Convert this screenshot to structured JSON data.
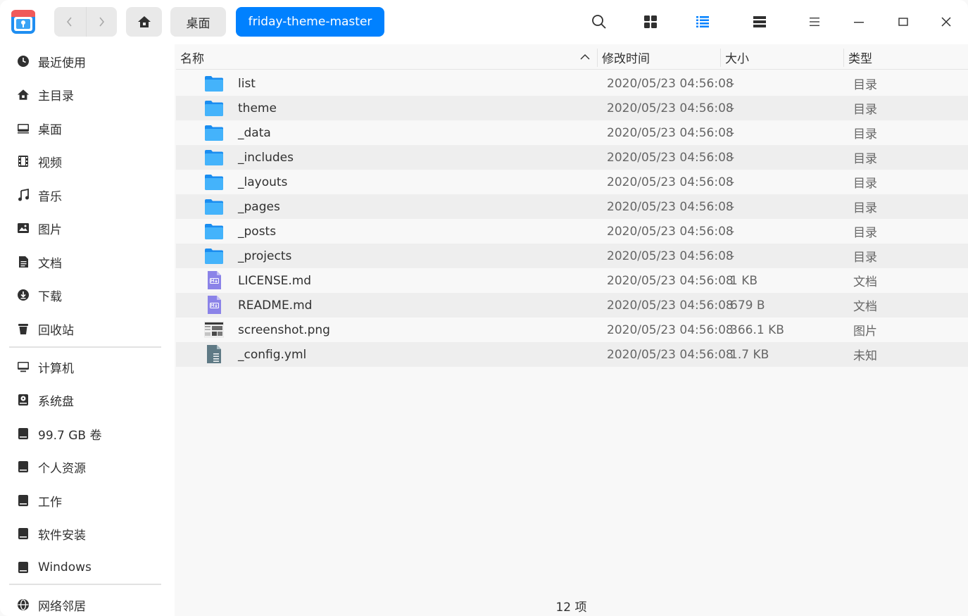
{
  "breadcrumbs": {
    "parent": "桌面",
    "current": "friday-theme-master"
  },
  "toolbar": {
    "icons": [
      "search-icon",
      "icon-view-icon",
      "list-view-icon",
      "detail-view-icon",
      "menu-icon",
      "minimize-icon",
      "maximize-icon",
      "close-icon"
    ]
  },
  "colors": {
    "accent": "#0081ff",
    "folder": "#2da0f2",
    "markdown": "#8b83e8"
  },
  "sidebar": {
    "items": [
      {
        "label": "最近使用",
        "icon": "clock-icon"
      },
      {
        "label": "主目录",
        "icon": "home-icon"
      },
      {
        "label": "桌面",
        "icon": "desktop-icon"
      },
      {
        "label": "视频",
        "icon": "video-icon"
      },
      {
        "label": "音乐",
        "icon": "music-icon"
      },
      {
        "label": "图片",
        "icon": "picture-icon"
      },
      {
        "label": "文档",
        "icon": "document-icon"
      },
      {
        "label": "下载",
        "icon": "download-icon"
      },
      {
        "label": "回收站",
        "icon": "trash-icon"
      }
    ],
    "devices": [
      {
        "label": "计算机",
        "icon": "computer-icon"
      },
      {
        "label": "系统盘",
        "icon": "system-disk-icon"
      },
      {
        "label": "99.7 GB 卷",
        "icon": "drive-icon"
      },
      {
        "label": "个人资源",
        "icon": "drive-icon"
      },
      {
        "label": "工作",
        "icon": "drive-icon"
      },
      {
        "label": "软件安装",
        "icon": "drive-icon"
      },
      {
        "label": "Windows",
        "icon": "drive-icon"
      }
    ],
    "network": {
      "label": "网络邻居",
      "icon": "network-icon"
    }
  },
  "columns": {
    "name": "名称",
    "modified": "修改时间",
    "size": "大小",
    "type": "类型"
  },
  "files": [
    {
      "name": "list",
      "modified": "2020/05/23 04:56:08",
      "size": "-",
      "type": "目录",
      "icon": "folder-icon"
    },
    {
      "name": "theme",
      "modified": "2020/05/23 04:56:08",
      "size": "-",
      "type": "目录",
      "icon": "folder-icon"
    },
    {
      "name": "_data",
      "modified": "2020/05/23 04:56:08",
      "size": "-",
      "type": "目录",
      "icon": "folder-icon"
    },
    {
      "name": "_includes",
      "modified": "2020/05/23 04:56:08",
      "size": "-",
      "type": "目录",
      "icon": "folder-icon"
    },
    {
      "name": "_layouts",
      "modified": "2020/05/23 04:56:08",
      "size": "-",
      "type": "目录",
      "icon": "folder-icon"
    },
    {
      "name": "_pages",
      "modified": "2020/05/23 04:56:08",
      "size": "-",
      "type": "目录",
      "icon": "folder-icon"
    },
    {
      "name": "_posts",
      "modified": "2020/05/23 04:56:08",
      "size": "-",
      "type": "目录",
      "icon": "folder-icon"
    },
    {
      "name": "_projects",
      "modified": "2020/05/23 04:56:08",
      "size": "-",
      "type": "目录",
      "icon": "folder-icon"
    },
    {
      "name": "LICENSE.md",
      "modified": "2020/05/23 04:56:08",
      "size": "1 KB",
      "type": "文档",
      "icon": "markdown-file-icon"
    },
    {
      "name": "README.md",
      "modified": "2020/05/23 04:56:08",
      "size": "679 B",
      "type": "文档",
      "icon": "markdown-file-icon"
    },
    {
      "name": "screenshot.png",
      "modified": "2020/05/23 04:56:08",
      "size": "366.1 KB",
      "type": "图片",
      "icon": "image-thumbnail-icon"
    },
    {
      "name": "_config.yml",
      "modified": "2020/05/23 04:56:08",
      "size": "1.7 KB",
      "type": "未知",
      "icon": "text-file-icon"
    }
  ],
  "status": {
    "count": "12 项"
  }
}
